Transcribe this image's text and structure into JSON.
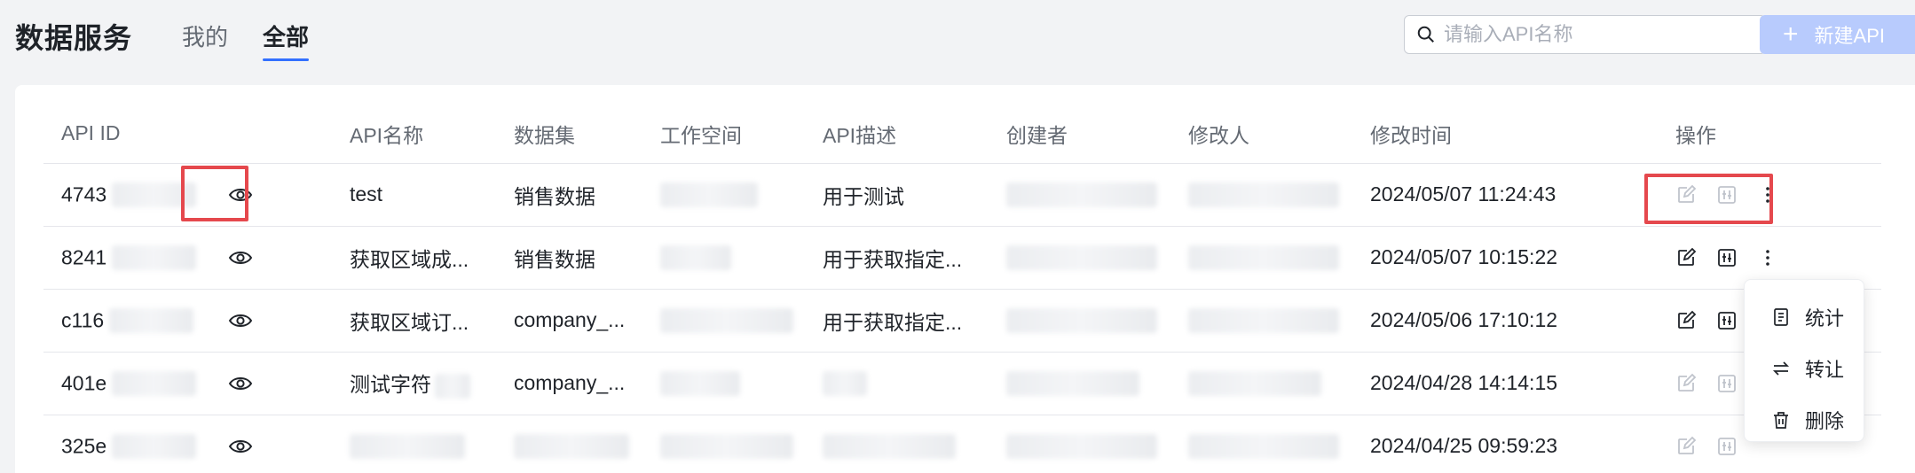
{
  "header": {
    "title": "数据服务",
    "tabs": [
      {
        "label": "我的",
        "active": false
      },
      {
        "label": "全部",
        "active": true
      }
    ],
    "search_placeholder": "请输入API名称",
    "new_button_label": "新建API"
  },
  "table": {
    "columns": [
      "API ID",
      "API名称",
      "数据集",
      "工作空间",
      "API描述",
      "创建者",
      "修改人",
      "修改时间",
      "操作"
    ],
    "rows": [
      {
        "id_prefix": "4743",
        "name": "test",
        "dataset": "销售数据",
        "description": "用于测试",
        "modified_time": "2024/05/07 11:24:43",
        "actions_enabled": false
      },
      {
        "id_prefix": "8241",
        "name": "获取区域成...",
        "dataset": "销售数据",
        "description": "用于获取指定...",
        "modified_time": "2024/05/07 10:15:22",
        "actions_enabled": true
      },
      {
        "id_prefix": "c116",
        "name": "获取区域订...",
        "dataset": "company_...",
        "description": "用于获取指定...",
        "modified_time": "2024/05/06 17:10:12",
        "actions_enabled": true
      },
      {
        "id_prefix": "401e",
        "name": "测试字符",
        "dataset": "company_...",
        "description": "",
        "modified_time": "2024/04/28 14:14:15",
        "actions_enabled": false
      },
      {
        "id_prefix": "325e",
        "name": "",
        "dataset": "",
        "description": "",
        "modified_time": "2024/04/25 09:59:23",
        "actions_enabled": false
      }
    ]
  },
  "dropdown_menu": {
    "items": [
      {
        "label": "统计",
        "icon": "report-icon"
      },
      {
        "label": "转让",
        "icon": "transfer-icon"
      },
      {
        "label": "删除",
        "icon": "trash-icon"
      }
    ]
  },
  "colors": {
    "accent": "#3370ff",
    "new_button_disabled": "#b8cbfd",
    "highlight": "#e5484d"
  }
}
